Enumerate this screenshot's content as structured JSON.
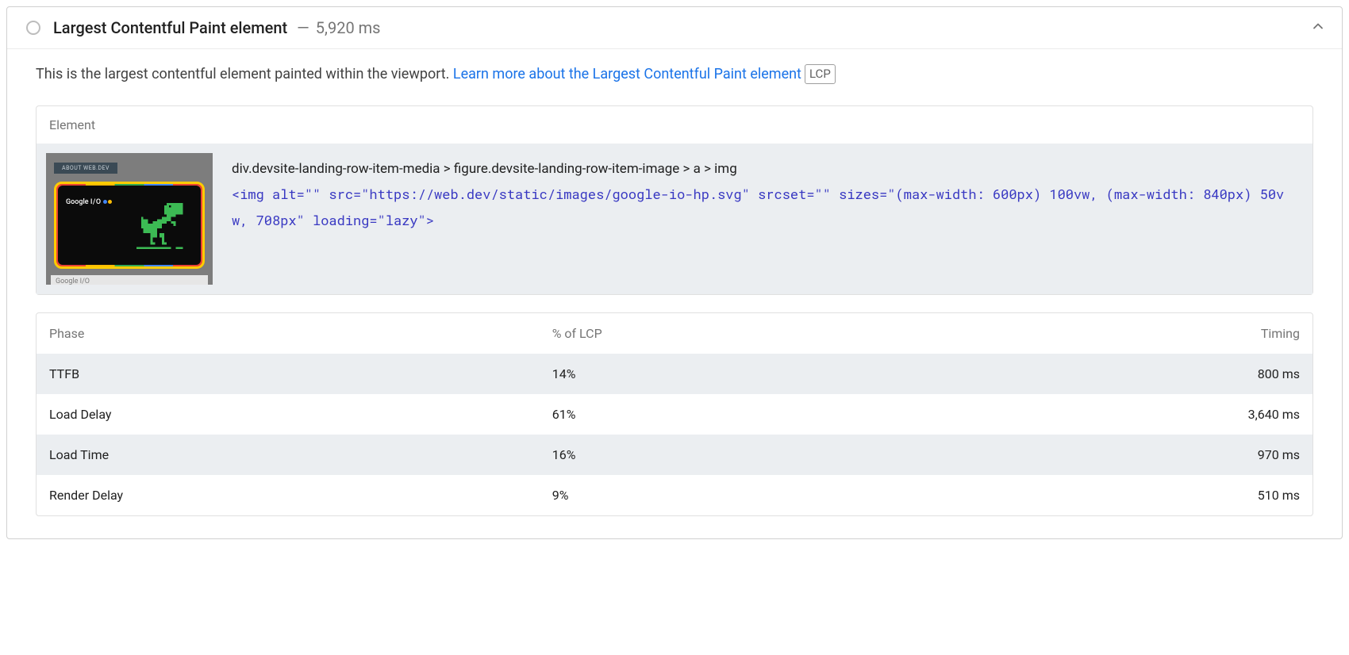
{
  "audit": {
    "title": "Largest Contentful Paint element",
    "timing": "5,920 ms",
    "description_prefix": "This is the largest contentful element painted within the viewport. ",
    "learn_more": "Learn more about the Largest Contentful Paint element",
    "badge": "LCP"
  },
  "element_section": {
    "header": "Element",
    "thumb": {
      "tab_label": "ABOUT WEB.DEV",
      "brand": "Google",
      "brand_io": "I/O",
      "caption": "Google I/O"
    },
    "selector": "div.devsite-landing-row-item-media > figure.devsite-landing-row-item-image > a > img",
    "snippet": "<img alt=\"\" src=\"https://web.dev/static/images/google-io-hp.svg\" srcset=\"\" sizes=\"(max-width: 600px) 100vw, (max-width: 840px) 50vw, 708px\" loading=\"lazy\">"
  },
  "phase_table": {
    "columns": {
      "phase": "Phase",
      "pct": "% of LCP",
      "timing": "Timing"
    },
    "rows": [
      {
        "phase": "TTFB",
        "pct": "14%",
        "timing": "800 ms"
      },
      {
        "phase": "Load Delay",
        "pct": "61%",
        "timing": "3,640 ms"
      },
      {
        "phase": "Load Time",
        "pct": "16%",
        "timing": "970 ms"
      },
      {
        "phase": "Render Delay",
        "pct": "9%",
        "timing": "510 ms"
      }
    ]
  }
}
